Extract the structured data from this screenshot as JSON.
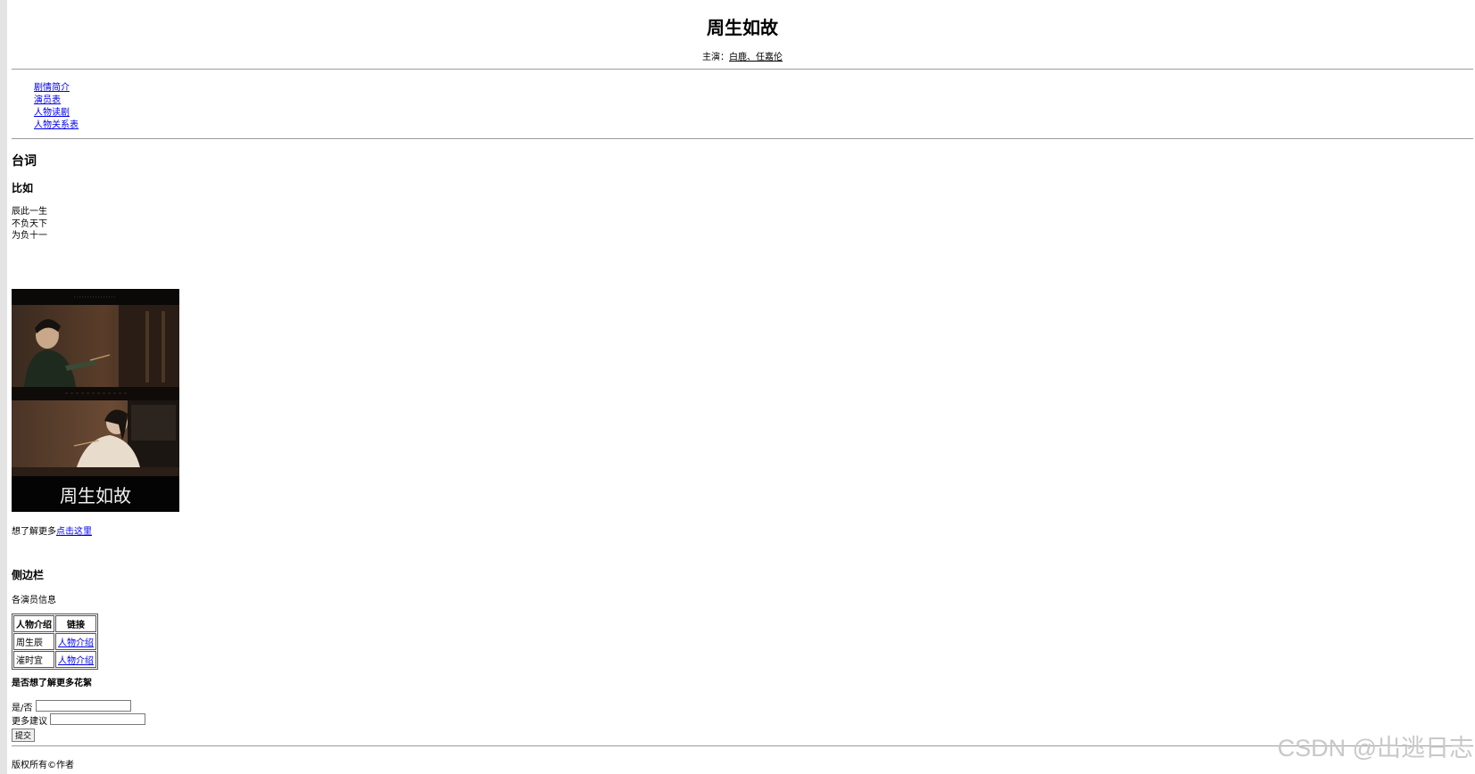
{
  "header": {
    "title": "周生如故",
    "starring_label": "主演：",
    "starring_link": "白鹿、任嘉伦"
  },
  "nav": {
    "items": [
      "剧情简介",
      "演员表",
      "人物读剧",
      "人物关系表"
    ]
  },
  "quotes": {
    "heading": "台词",
    "subheading": "比如",
    "lines": [
      "辰此一生",
      "不负天下",
      "为负十一"
    ]
  },
  "poster": {
    "title_text": "周生如故"
  },
  "more": {
    "prefix": "想了解更多",
    "link": "点击这里"
  },
  "sidebar": {
    "heading": "侧边栏",
    "caption": "各演员信息"
  },
  "table": {
    "headers": [
      "人物介绍",
      "链接"
    ],
    "rows": [
      {
        "name": "周生辰",
        "link": "人物介绍"
      },
      {
        "name": "漼时宜",
        "link": "人物介绍"
      }
    ]
  },
  "form": {
    "heading": "是否想了解更多花絮",
    "yesno_label": "是/否",
    "yesno_value": "",
    "suggest_label": "更多建议",
    "suggest_value": "",
    "submit_label": "提交"
  },
  "footer": {
    "copyright": "版权所有©作者"
  },
  "watermark": "CSDN @出逃日志",
  "colors": {
    "link": "#0000ee",
    "rule": "#9a9a9a",
    "left_strip": "#e4e4e4"
  }
}
